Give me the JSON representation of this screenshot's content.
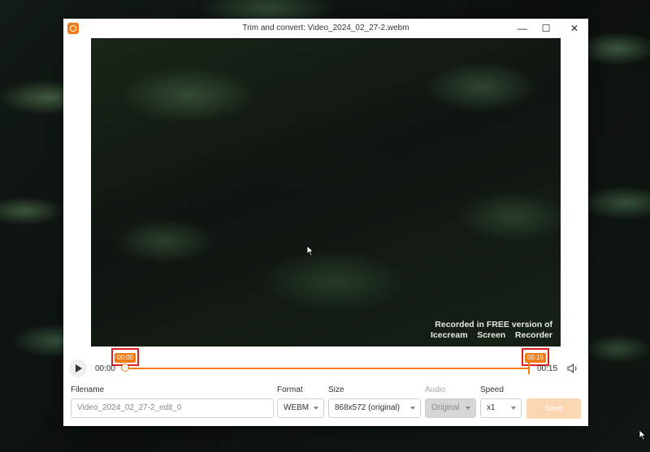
{
  "window": {
    "title": "Trim and convert: Video_2024_02_27-2.webm",
    "controls": {
      "minimize": "—",
      "maximize": "☐",
      "close": "✕"
    }
  },
  "video": {
    "watermark_line1": "Recorded in FREE version of",
    "watermark_line2": [
      "Icecream",
      "Screen",
      "Recorder"
    ]
  },
  "timeline": {
    "start_marker": "00:00",
    "end_marker": "00:15",
    "current_time": "00:00",
    "total_time": "00:15",
    "trim_start_fraction": 0,
    "trim_end_fraction": 1
  },
  "form": {
    "filename_label": "Filename",
    "filename_value": "Video_2024_02_27-2_edit_0",
    "format_label": "Format",
    "format_value": "WEBM",
    "size_label": "Size",
    "size_value": "868x572 (original)",
    "audio_label": "Audio",
    "audio_value": "Original",
    "speed_label": "Speed",
    "speed_value": "x1",
    "save_label": "Save"
  },
  "colors": {
    "accent": "#f07c1a",
    "highlight_box": "#e02020",
    "save_disabled": "#fbd6b3"
  },
  "icons": [
    "app-logo-icon",
    "minimize-icon",
    "maximize-icon",
    "close-icon",
    "play-icon",
    "volume-icon",
    "chevron-down-icon",
    "mouse-cursor-icon"
  ]
}
